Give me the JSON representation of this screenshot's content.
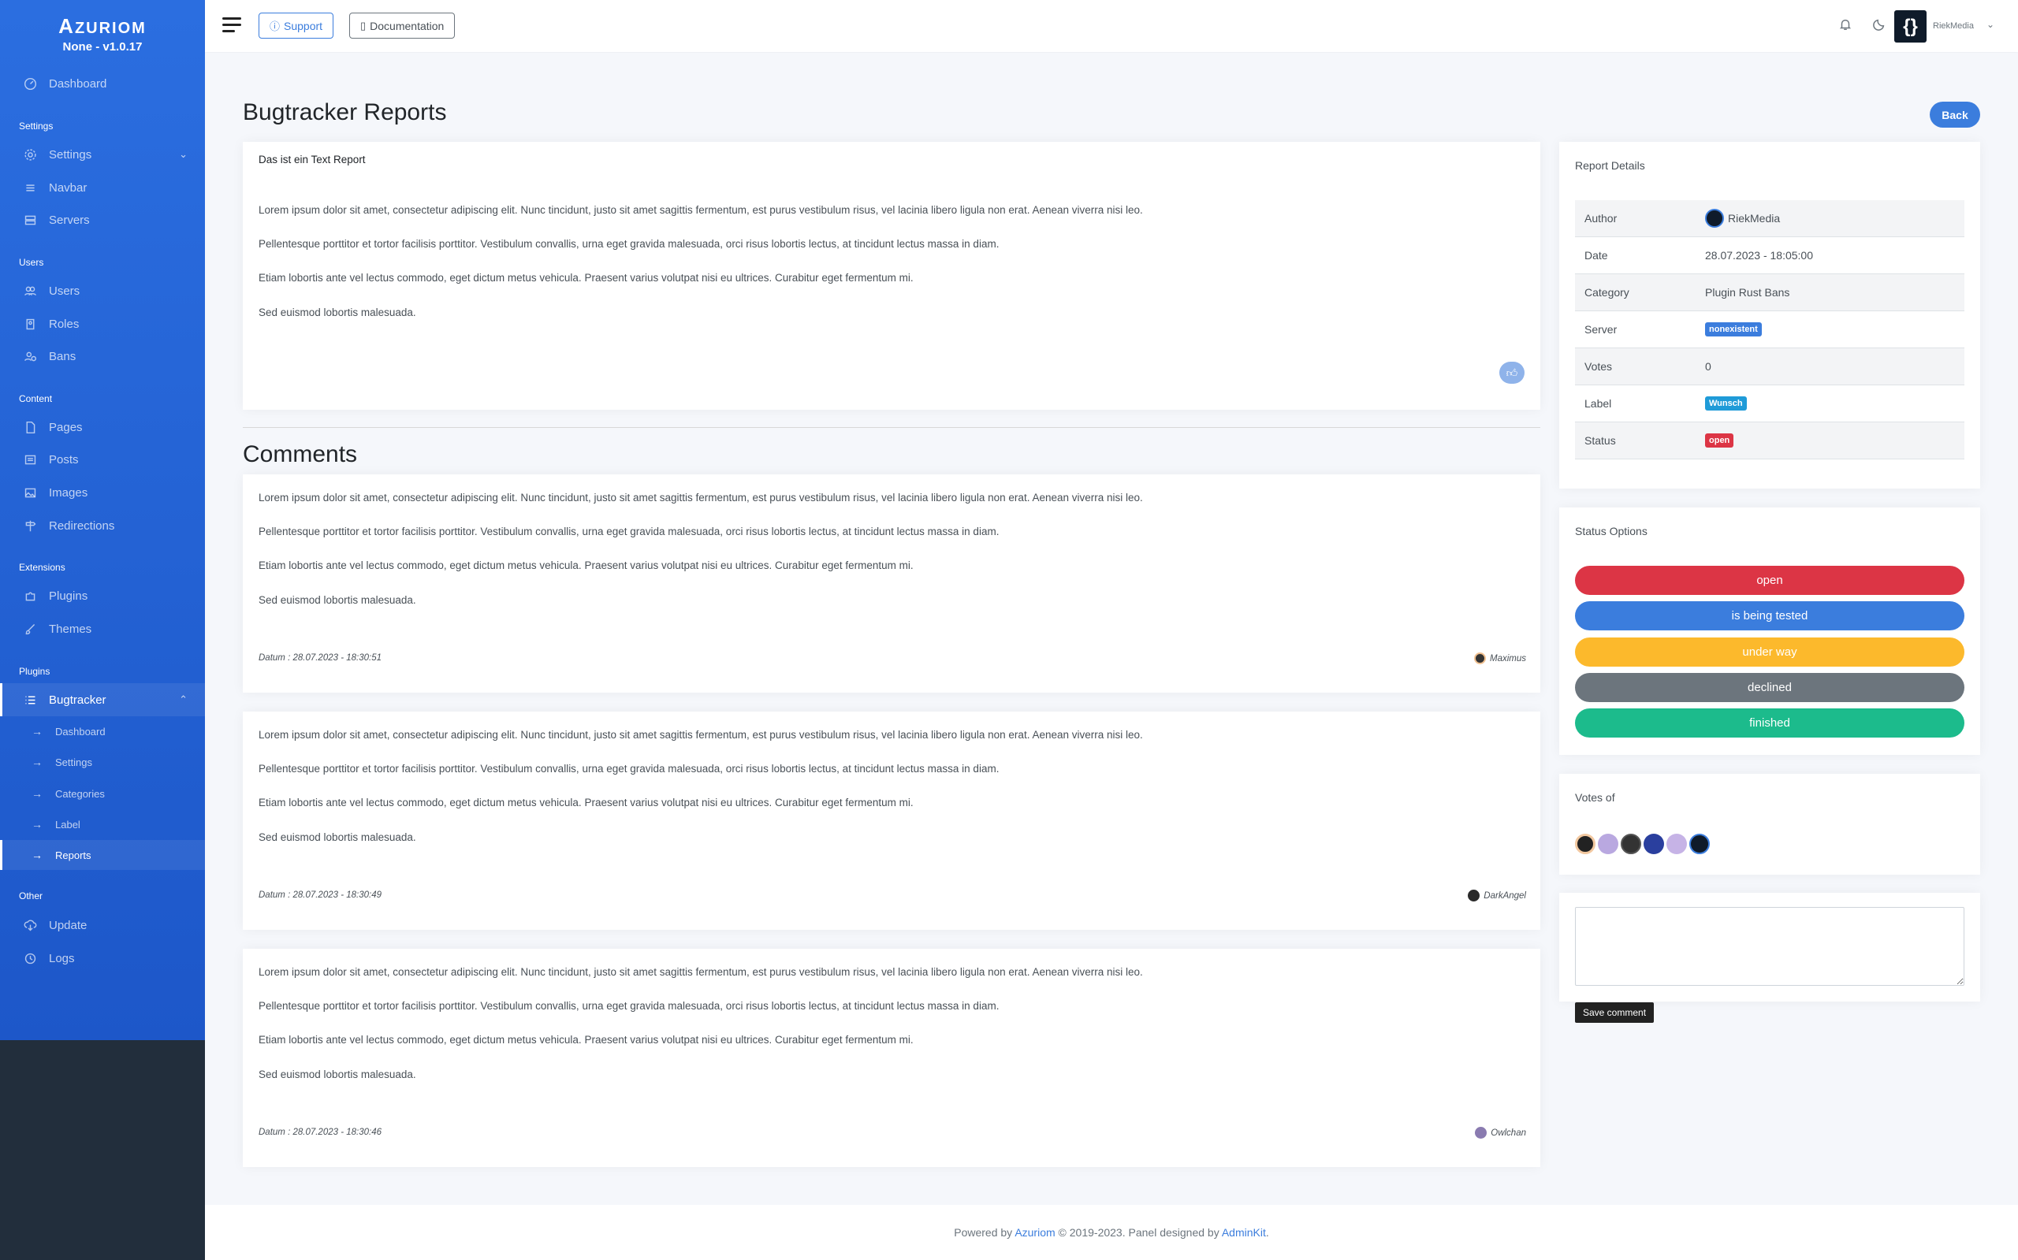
{
  "brand": {
    "name_initial": "A",
    "name_rest": "ZURIOM",
    "version": "None - v1.0.17"
  },
  "sidebar": {
    "dashboard": "Dashboard",
    "headings": {
      "settings": "Settings",
      "users": "Users",
      "content": "Content",
      "extensions": "Extensions",
      "plugins": "Plugins",
      "other": "Other"
    },
    "items": {
      "settings": "Settings",
      "navbar": "Navbar",
      "servers": "Servers",
      "users": "Users",
      "roles": "Roles",
      "bans": "Bans",
      "pages": "Pages",
      "posts": "Posts",
      "images": "Images",
      "redirections": "Redirections",
      "plugins": "Plugins",
      "themes": "Themes",
      "bugtracker": "Bugtracker",
      "update": "Update",
      "logs": "Logs"
    },
    "bugtracker_sub": {
      "dashboard": "Dashboard",
      "settings": "Settings",
      "categories": "Categories",
      "label": "Label",
      "reports": "Reports"
    }
  },
  "topbar": {
    "support": "Support",
    "documentation": "Documentation",
    "user_name": "RiekMedia"
  },
  "page": {
    "title": "Bugtracker Reports",
    "back": "Back",
    "comments_title": "Comments"
  },
  "report": {
    "title": "Das ist ein Text Report",
    "paragraphs": [
      "Lorem ipsum dolor sit amet, consectetur adipiscing elit. Nunc tincidunt, justo sit amet sagittis fermentum, est purus vestibulum risus, vel lacinia libero ligula non erat. Aenean viverra nisi leo.",
      "Pellentesque porttitor et tortor facilisis porttitor. Vestibulum convallis, urna eget gravida malesuada, orci risus lobortis lectus, at tincidunt lectus massa in diam.",
      "Etiam lobortis ante vel lectus commodo, eget dictum metus vehicula. Praesent varius volutpat nisi eu ultrices. Curabitur eget fermentum mi.",
      "Sed euismod lobortis malesuada."
    ]
  },
  "comments": [
    {
      "date": "Datum : 28.07.2023 - 18:30:51",
      "author": "Maximus"
    },
    {
      "date": "Datum : 28.07.2023 - 18:30:49",
      "author": "DarkAngel"
    },
    {
      "date": "Datum : 28.07.2023 - 18:30:46",
      "author": "Owlchan"
    }
  ],
  "details": {
    "title": "Report Details",
    "rows": [
      {
        "key": "Author",
        "value": "RiekMedia"
      },
      {
        "key": "Date",
        "value": "28.07.2023 - 18:05:00"
      },
      {
        "key": "Category",
        "value": "Plugin Rust Bans"
      },
      {
        "key": "Server",
        "value": "nonexistent"
      },
      {
        "key": "Votes",
        "value": "0"
      },
      {
        "key": "Label",
        "value": "Wunsch"
      },
      {
        "key": "Status",
        "value": "open"
      }
    ]
  },
  "status_options": {
    "title": "Status Options",
    "buttons": [
      "open",
      "is being tested",
      "under way",
      "declined",
      "finished"
    ],
    "colors": [
      "#dc3545",
      "#3b7ddd",
      "#fcb92c",
      "#6c757d",
      "#1cbb8c"
    ]
  },
  "votes": {
    "title": "Votes of"
  },
  "comment_form": {
    "save": "Save comment"
  },
  "footer": {
    "prefix": "Powered by ",
    "azuriom": "Azuriom",
    "middle": " © 2019-2023. Panel designed by ",
    "adminkit": "AdminKit",
    "suffix": "."
  }
}
